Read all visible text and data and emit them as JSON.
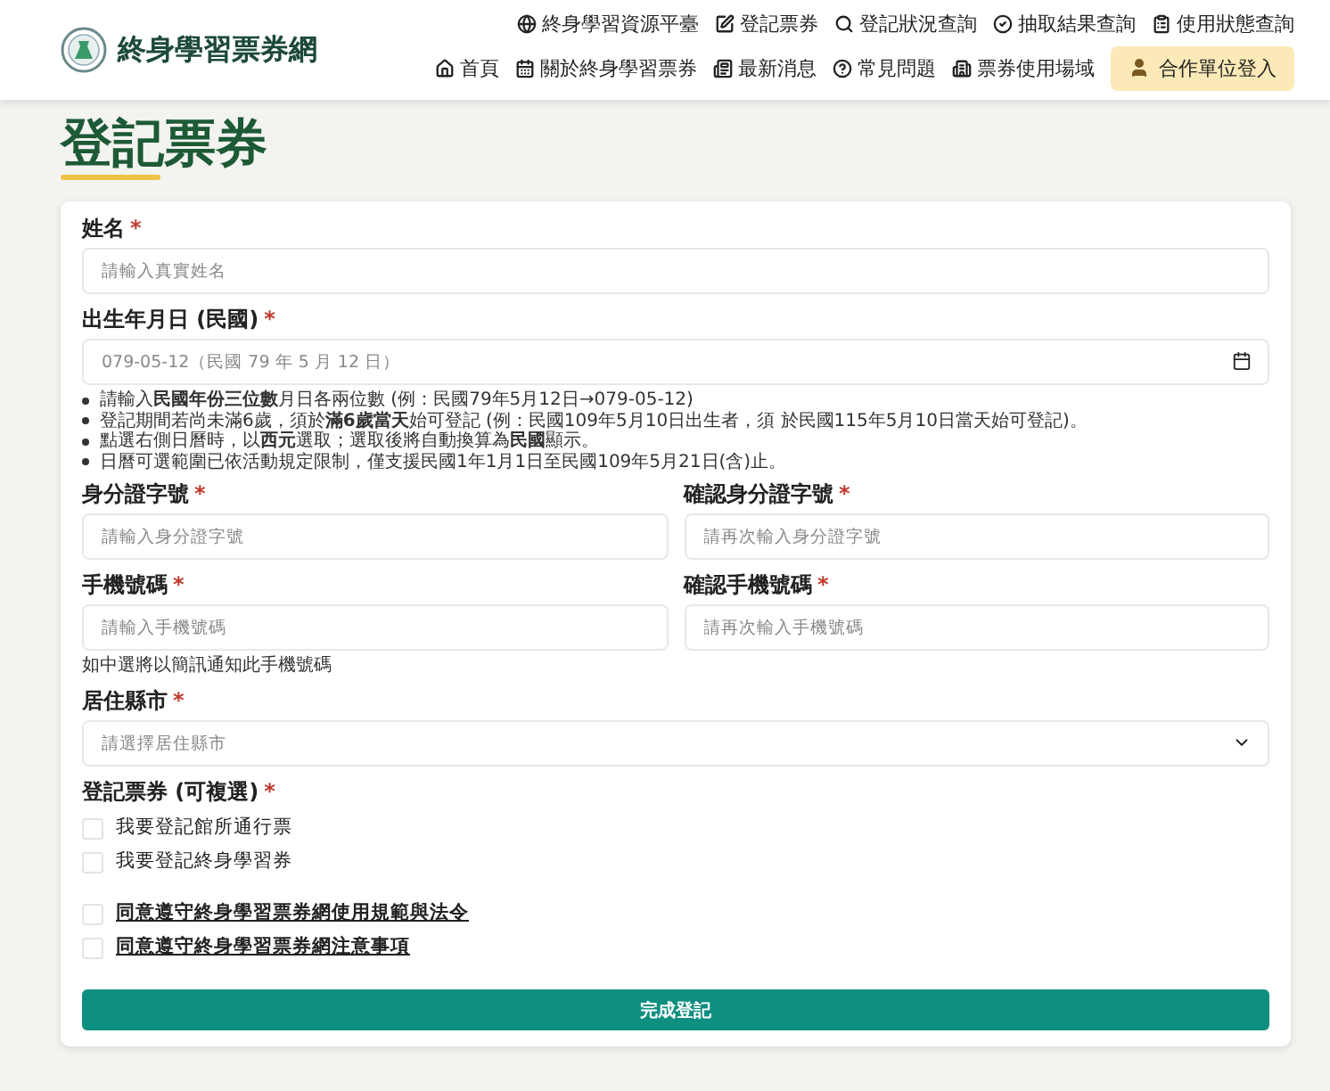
{
  "header": {
    "site_title": "終身學習票券網",
    "top_links": [
      {
        "kind": "globe",
        "label": "終身學習資源平臺"
      },
      {
        "kind": "edit",
        "label": "登記票券"
      },
      {
        "kind": "search",
        "label": "登記狀況查詢"
      },
      {
        "kind": "check",
        "label": "抽取結果查詢"
      },
      {
        "kind": "clipboard",
        "label": "使用狀態查詢"
      }
    ],
    "main_links": [
      {
        "kind": "home",
        "label": "首頁"
      },
      {
        "kind": "calendar",
        "label": "關於終身學習票券"
      },
      {
        "kind": "news",
        "label": "最新消息"
      },
      {
        "kind": "help",
        "label": "常見問題"
      },
      {
        "kind": "building",
        "label": "票券使用場域"
      }
    ],
    "login_button": "合作單位登入"
  },
  "page_title": "登記票券",
  "form": {
    "name": {
      "label": "姓名",
      "required_mark": "*",
      "placeholder": "請輸入真實姓名"
    },
    "birth": {
      "label": "出生年月日 (民國)",
      "required_mark": "*",
      "placeholder": "079-05-12（民國 79 年 5 月 12 日）",
      "notes": [
        "請輸入**民國年份三位數**月日各兩位數 (例：民國79年5月12日→079-05-12)",
        "登記期間若尚未滿6歲，須於**滿6歲當天**始可登記 (例：民國109年5月10日出生者，須 於民國115年5月10日當天始可登記)。",
        "點選右側日曆時，以**西元**選取；選取後將自動換算為**民國**顯示。",
        "日曆可選範圍已依活動規定限制，僅支援民國1年1月1日至民國109年5月21日(含)止。"
      ]
    },
    "id_pair": [
      {
        "label": "身分證字號",
        "required_mark": "*",
        "placeholder": "請輸入身分證字號"
      },
      {
        "label": "確認身分證字號",
        "required_mark": "*",
        "placeholder": "請再次輸入身分證字號"
      }
    ],
    "phone_pair": [
      {
        "label": "手機號碼",
        "required_mark": "*",
        "placeholder": "請輸入手機號碼"
      },
      {
        "label": "確認手機號碼",
        "required_mark": "*",
        "placeholder": "請再次輸入手機號碼"
      }
    ],
    "phone_note": "如中選將以簡訊通知此手機號碼",
    "city": {
      "label": "居住縣市",
      "required_mark": "*",
      "placeholder": "請選擇居住縣市"
    },
    "tickets": {
      "label": "登記票券 (可複選)",
      "required_mark": "*",
      "options": [
        {
          "label": "我要登記館所通行票",
          "checked": false
        },
        {
          "label": "我要登記終身學習券",
          "checked": false
        }
      ]
    },
    "agreements": [
      {
        "label": "同意遵守終身學習票券網使用規範與法令",
        "checked": false
      },
      {
        "label": "同意遵守終身學習票券網注意事項",
        "checked": false
      }
    ],
    "submit": "完成登記"
  }
}
